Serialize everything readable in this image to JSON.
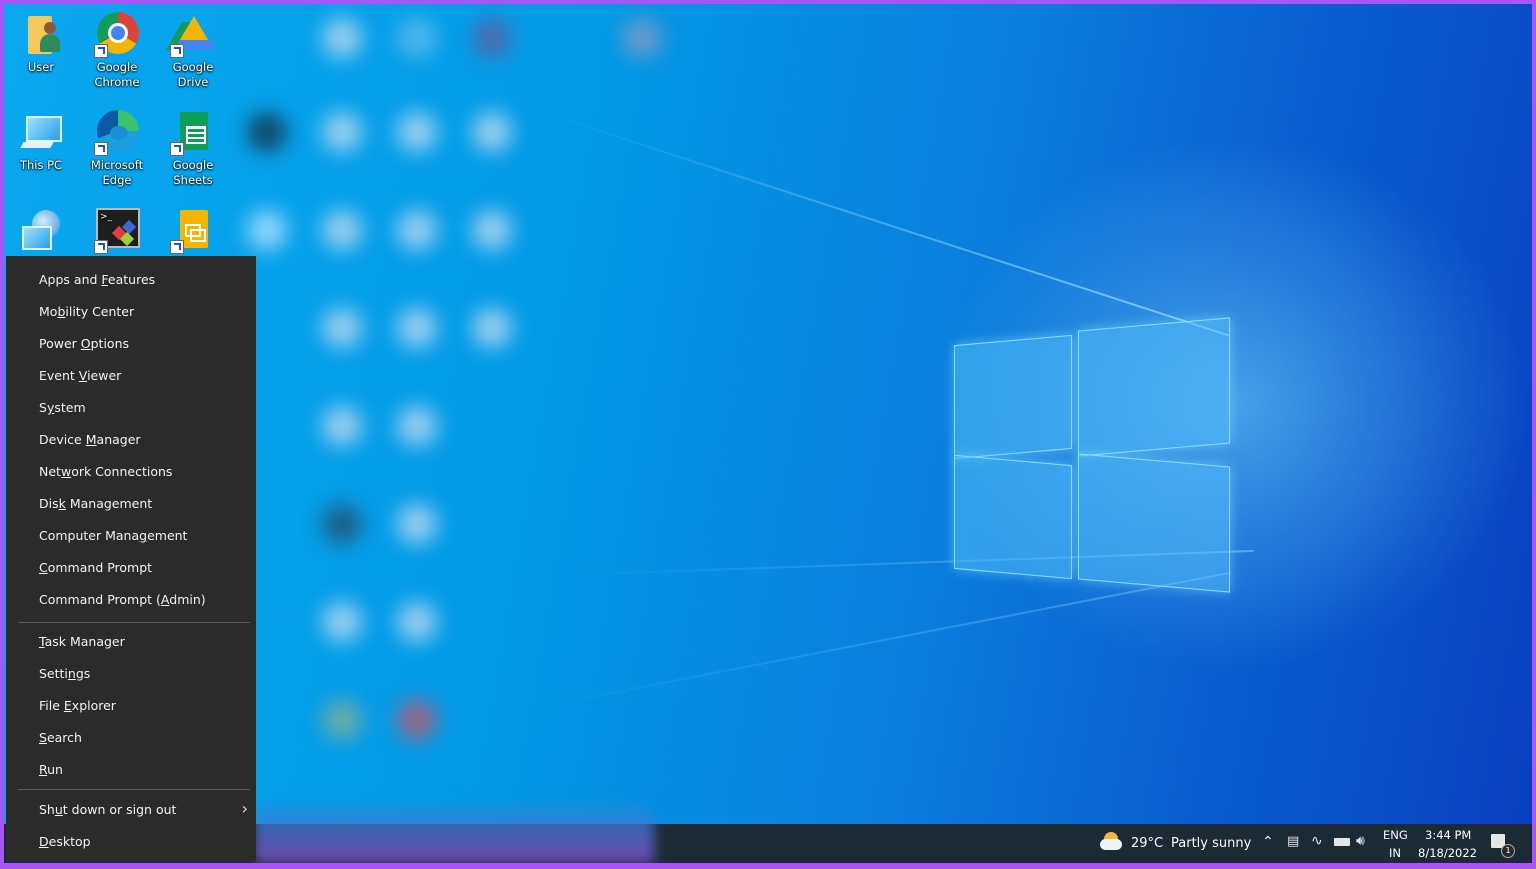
{
  "desktop": {
    "icons": [
      {
        "label": "User",
        "icon": "user-folder-icon"
      },
      {
        "label": "Google Chrome",
        "icon": "chrome-icon"
      },
      {
        "label": "Google Drive",
        "icon": "google-drive-icon"
      },
      {
        "label": "This PC",
        "icon": "this-pc-icon"
      },
      {
        "label": "Microsoft Edge",
        "icon": "edge-icon"
      },
      {
        "label": "Google Sheets",
        "icon": "google-sheets-icon"
      },
      {
        "label": "",
        "icon": "network-icon"
      },
      {
        "label": "",
        "icon": "terminal-app-icon"
      },
      {
        "label": "",
        "icon": "google-slides-icon"
      }
    ]
  },
  "menu": {
    "items": [
      {
        "label": "Apps and Features",
        "accel": "F"
      },
      {
        "label": "Mobility Center",
        "accel": "b"
      },
      {
        "label": "Power Options",
        "accel": "O"
      },
      {
        "label": "Event Viewer",
        "accel": "V"
      },
      {
        "label": "System",
        "accel": "y"
      },
      {
        "label": "Device Manager",
        "accel": "M"
      },
      {
        "label": "Network Connections",
        "accel": "w"
      },
      {
        "label": "Disk Management",
        "accel": "k"
      },
      {
        "label": "Computer Management",
        "accel": "g"
      },
      {
        "label": "Command Prompt",
        "accel": "C"
      },
      {
        "label": "Command Prompt (Admin)",
        "accel": "A"
      },
      {
        "label": "Task Manager",
        "accel": "T"
      },
      {
        "label": "Settings",
        "accel": "n"
      },
      {
        "label": "File Explorer",
        "accel": "E"
      },
      {
        "label": "Search",
        "accel": "S"
      },
      {
        "label": "Run",
        "accel": "R"
      },
      {
        "label": "Shut down or sign out",
        "accel": "u",
        "submenu": true
      },
      {
        "label": "Desktop",
        "accel": "D"
      }
    ]
  },
  "taskbar": {
    "weather": {
      "temp": "29°C",
      "condition": "Partly sunny"
    },
    "language": {
      "line1": "ENG",
      "line2": "IN"
    },
    "clock": {
      "time": "3:44 PM",
      "date": "8/18/2022"
    },
    "notifications": {
      "count": "1"
    }
  }
}
